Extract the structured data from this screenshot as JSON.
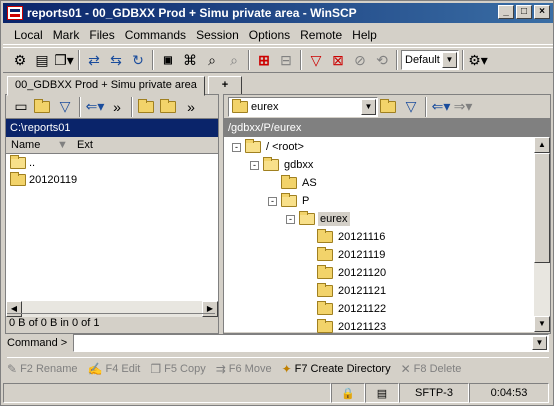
{
  "window": {
    "title": "reports01 - 00_GDBXX Prod + Simu private area - WinSCP"
  },
  "menu": [
    "Local",
    "Mark",
    "Files",
    "Commands",
    "Session",
    "Options",
    "Remote",
    "Help"
  ],
  "toolbar": {
    "transfer_setting": "Default"
  },
  "tabs": [
    {
      "label": "00_GDBXX Prod + Simu private area"
    },
    {
      "label": "+"
    }
  ],
  "local": {
    "path": "C:\\reports01",
    "columns": [
      "Name",
      "Ext"
    ],
    "files": [
      {
        "name": ".."
      },
      {
        "name": "20120119"
      }
    ],
    "status": "0 B of 0 B in 0 of 1"
  },
  "remote": {
    "dir_combo": "eurex",
    "path": "/gdbxx/P/eurex",
    "tree": [
      {
        "label": "/ <root>",
        "level": 0,
        "exp": "-"
      },
      {
        "label": "gdbxx",
        "level": 1,
        "exp": "-"
      },
      {
        "label": "AS",
        "level": 2,
        "exp": ""
      },
      {
        "label": "P",
        "level": 2,
        "exp": "-"
      },
      {
        "label": "eurex",
        "level": 3,
        "exp": "-",
        "selected": true
      },
      {
        "label": "20121116",
        "level": 4,
        "exp": ""
      },
      {
        "label": "20121119",
        "level": 4,
        "exp": ""
      },
      {
        "label": "20121120",
        "level": 4,
        "exp": ""
      },
      {
        "label": "20121121",
        "level": 4,
        "exp": ""
      },
      {
        "label": "20121122",
        "level": 4,
        "exp": ""
      },
      {
        "label": "20121123",
        "level": 4,
        "exp": ""
      }
    ]
  },
  "command": {
    "label": "Command >"
  },
  "fkeys": [
    {
      "label": "F2 Rename",
      "enabled": false,
      "icon": "rename-icon"
    },
    {
      "label": "F4 Edit",
      "enabled": false,
      "icon": "edit-icon"
    },
    {
      "label": "F5 Copy",
      "enabled": false,
      "icon": "copy-icon"
    },
    {
      "label": "F6 Move",
      "enabled": false,
      "icon": "move-icon"
    },
    {
      "label": "F7 Create Directory",
      "enabled": true,
      "icon": "create-directory-icon"
    },
    {
      "label": "F8 Delete",
      "enabled": false,
      "icon": "delete-icon"
    }
  ],
  "statusbar": {
    "protocol": "SFTP-3",
    "time": "0:04:53"
  }
}
